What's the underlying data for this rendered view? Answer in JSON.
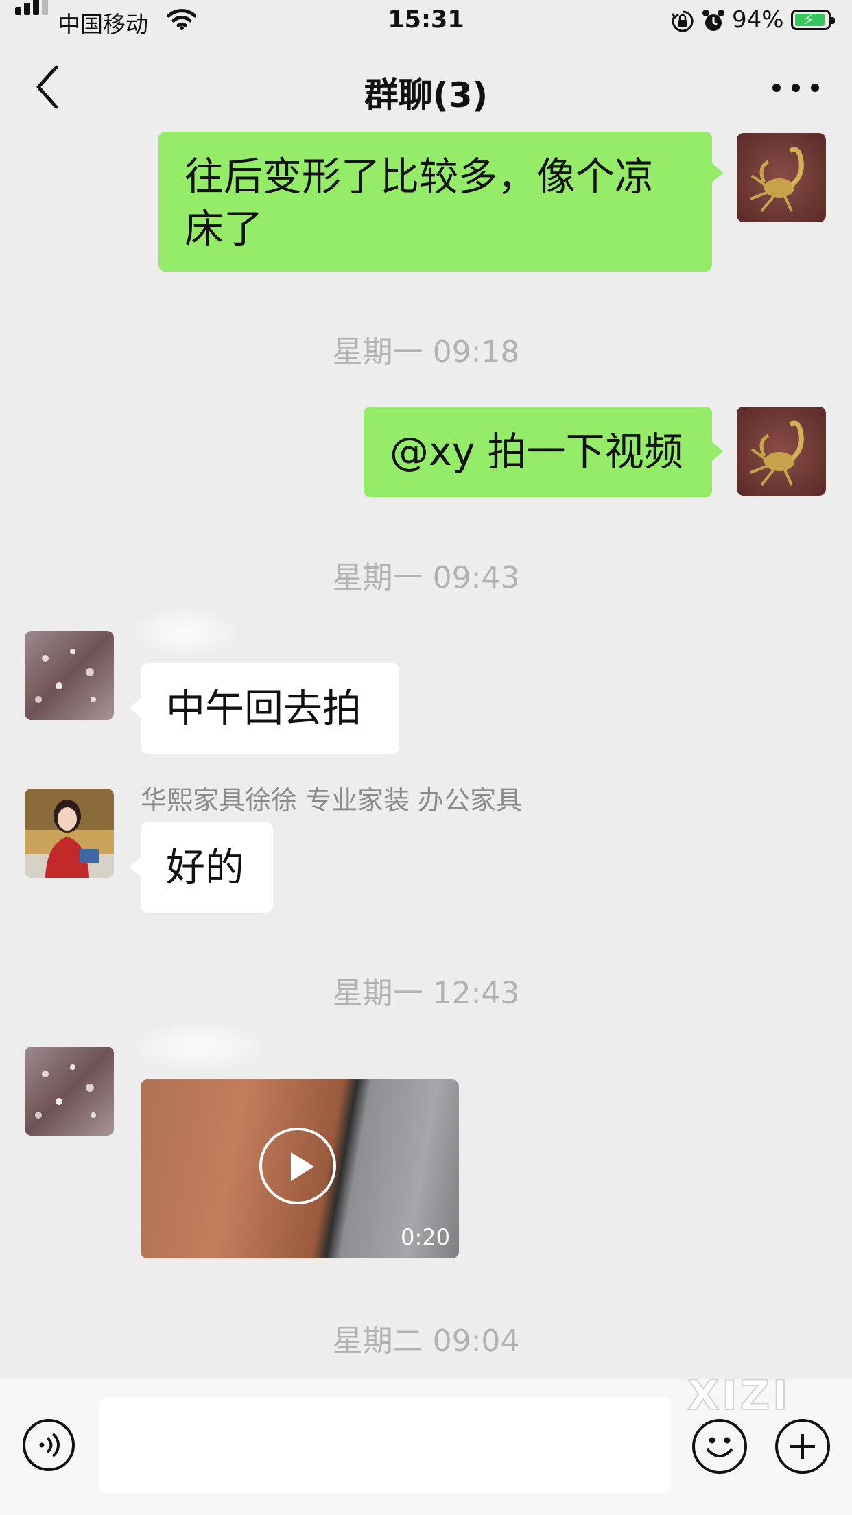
{
  "status_bar": {
    "carrier": "中国移动",
    "time": "15:31",
    "battery_percent": "94%",
    "battery_level": 0.94,
    "icons": [
      "signal-icon",
      "wifi-icon",
      "rotation-lock-icon",
      "alarm-icon",
      "battery-charging-icon"
    ]
  },
  "nav": {
    "title": "群聊(3)",
    "back_icon": "chevron-left-icon",
    "more_icon": "more-dots-icon"
  },
  "messages": [
    {
      "type": "text",
      "direction": "outgoing",
      "lines": [
        "往后变形了比较多，像个凉",
        "床了"
      ]
    },
    {
      "type": "timestamp",
      "text": "星期一 09:18"
    },
    {
      "type": "text",
      "direction": "outgoing",
      "text": "@xy 拍一下视频"
    },
    {
      "type": "timestamp",
      "text": "星期一 09:43"
    },
    {
      "type": "text",
      "direction": "incoming",
      "text": "中午回去拍"
    },
    {
      "type": "text",
      "direction": "incoming",
      "sender": "华熙家具徐徐 专业家装 办公家具",
      "text": "好的"
    },
    {
      "type": "timestamp",
      "text": "星期一 12:43"
    },
    {
      "type": "video",
      "direction": "incoming",
      "duration": "0:20"
    },
    {
      "type": "timestamp",
      "text": "星期二 09:04"
    }
  ],
  "input_bar": {
    "voice_icon": "voice-input-icon",
    "emoji_icon": "emoji-icon",
    "plus_icon": "plus-icon",
    "value": ""
  },
  "watermark": "XIZI",
  "colors": {
    "background": "#ededed",
    "outgoing_bubble": "#95ec69",
    "incoming_bubble": "#ffffff",
    "timestamp_text": "#b2b2b2",
    "battery_fill": "#34c759"
  }
}
